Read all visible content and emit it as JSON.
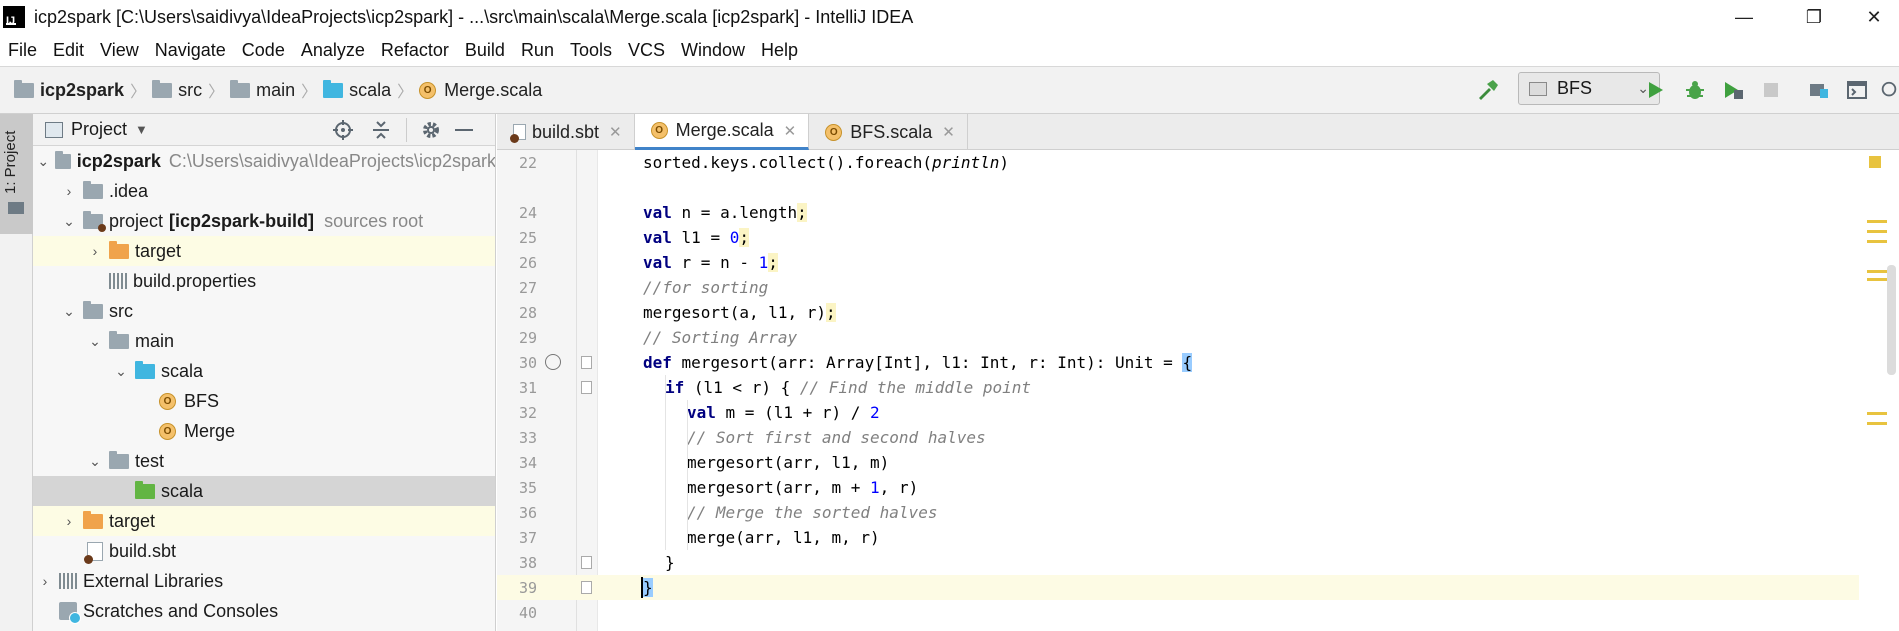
{
  "window": {
    "title": "icp2spark [C:\\Users\\saidivya\\IdeaProjects\\icp2spark] - ...\\src\\main\\scala\\Merge.scala [icp2spark] - IntelliJ IDEA",
    "minimize": "—",
    "restore": "❐",
    "close": "✕"
  },
  "menu": [
    "File",
    "Edit",
    "View",
    "Navigate",
    "Code",
    "Analyze",
    "Refactor",
    "Build",
    "Run",
    "Tools",
    "VCS",
    "Window",
    "Help"
  ],
  "breadcrumb": {
    "project": "icp2spark",
    "src": "src",
    "main": "main",
    "scala": "scala",
    "file": "Merge.scala"
  },
  "toolbar": {
    "run_config": "BFS"
  },
  "left_stripe": {
    "project_tab": "1: Project"
  },
  "project_panel": {
    "title": "Project",
    "tree": {
      "root": "icp2spark",
      "root_path": "C:\\Users\\saidivya\\IdeaProjects\\icp2spark",
      "idea": ".idea",
      "project": "project",
      "project_module": "[icp2spark-build]",
      "project_note": "sources root",
      "project_target": "target",
      "build_properties": "build.properties",
      "src": "src",
      "main": "main",
      "scala": "scala",
      "bfs": "BFS",
      "merge": "Merge",
      "test": "test",
      "test_scala": "scala",
      "target": "target",
      "build_sbt": "build.sbt",
      "external_libraries": "External Libraries",
      "scratches": "Scratches and Consoles"
    }
  },
  "tabs": [
    {
      "label": "build.sbt",
      "active": false
    },
    {
      "label": "Merge.scala",
      "active": true
    },
    {
      "label": "BFS.scala",
      "active": false
    }
  ],
  "editor": {
    "lines": [
      {
        "n": "22"
      },
      {
        "n": ""
      },
      {
        "n": "24"
      },
      {
        "n": "25"
      },
      {
        "n": "26"
      },
      {
        "n": "27"
      },
      {
        "n": "28"
      },
      {
        "n": "29"
      },
      {
        "n": "30"
      },
      {
        "n": "31"
      },
      {
        "n": "32"
      },
      {
        "n": "33"
      },
      {
        "n": "34"
      },
      {
        "n": "35"
      },
      {
        "n": "36"
      },
      {
        "n": "37"
      },
      {
        "n": "38"
      },
      {
        "n": "39"
      },
      {
        "n": "40"
      }
    ],
    "text": {
      "l22a": "sorted.keys.collect().foreach(",
      "l22b": "println",
      "l22c": ")",
      "l24a": "val",
      "l24b": " n = a.length",
      "l25a": "val",
      "l25b": " l1 = ",
      "l25c": "0",
      "l26a": "val",
      "l26b": " r = n - ",
      "l26c": "1",
      "l27": "//for sorting",
      "l28": "mergesort(a, l1, r)",
      "l29": "// Sorting Array",
      "l30a": "def",
      "l30b": " mergesort(arr: Array[Int], l1: Int, r: Int): Unit = ",
      "l30c": "{",
      "l31a": "if",
      "l31b": " (l1 < r) { ",
      "l31c": "// Find the middle point",
      "l32a": "val",
      "l32b": " m = (l1 + r) / ",
      "l32c": "2",
      "l33": "// Sort first and second halves",
      "l34": "mergesort(arr, l1, m)",
      "l35a": "mergesort(arr, m + ",
      "l35b": "1",
      "l35c": ", r)",
      "l36": "// Merge the sorted halves",
      "l37": "merge(arr, l1, m, r)",
      "l38": "}",
      "l39": "}",
      "semicolon": ";"
    }
  }
}
